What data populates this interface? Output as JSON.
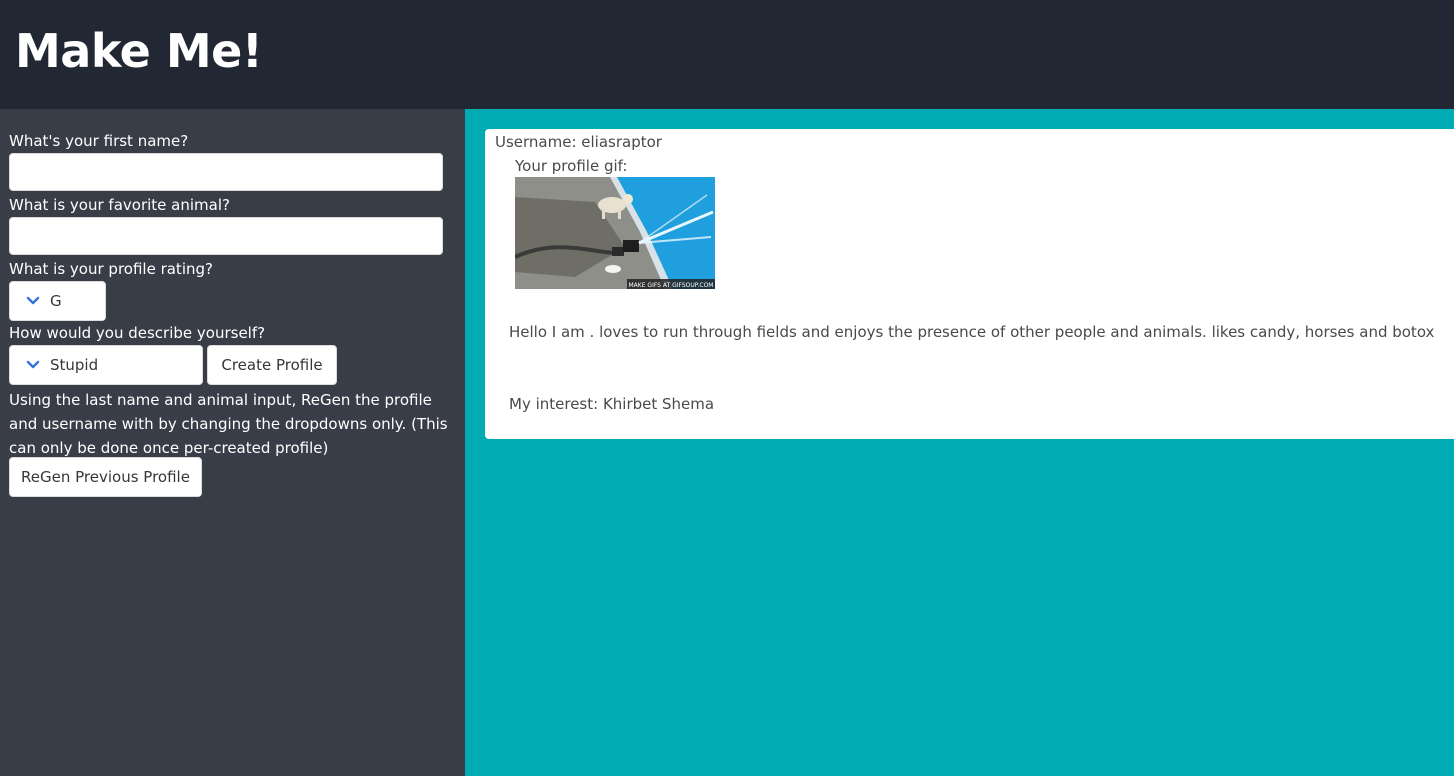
{
  "header": {
    "title": "Make Me!"
  },
  "form": {
    "first_name_label": "What's your first name?",
    "first_name_value": "",
    "animal_label": "What is your favorite animal?",
    "animal_value": "",
    "rating_label": "What is your profile rating?",
    "rating_value": "G",
    "describe_label": "How would you describe yourself?",
    "describe_value": "Stupid",
    "create_button": "Create Profile",
    "regen_note": "Using the last name and animal input, ReGen the profile and username with by changing the dropdowns only. (This can only be done once per-created profile)",
    "regen_button": "ReGen Previous Profile"
  },
  "profile": {
    "username": "Username: eliasraptor",
    "gif_label": "Your profile gif:",
    "gif_watermark": "MAKE GIFS AT GIFSOUP.COM",
    "bio": "Hello I am . loves to run through fields and enjoys the presence of other people and animals. likes candy, horses and botox",
    "interest": "My interest: Khirbet Shema"
  },
  "colors": {
    "header_bg": "#222833",
    "sidebar_bg": "#393d47",
    "main_bg": "#00abb4",
    "chevron": "#3273dc"
  },
  "icons": {
    "dropdown": "chevron-down-icon"
  }
}
